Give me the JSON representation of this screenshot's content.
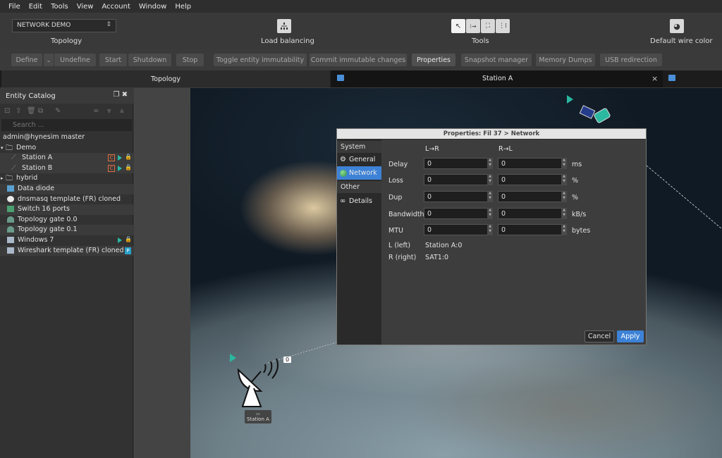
{
  "menu": [
    "File",
    "Edit",
    "Tools",
    "View",
    "Account",
    "Window",
    "Help"
  ],
  "toolbar": {
    "project": "NETWORK DEMO",
    "topology_label": "Topology",
    "load_balancing_label": "Load balancing",
    "tools_label": "Tools",
    "wire_color_label": "Default wire color"
  },
  "actions": {
    "define": "Define",
    "undefine": "Undefine",
    "start": "Start",
    "shutdown": "Shutdown",
    "stop": "Stop",
    "toggle": "Toggle entity immutability",
    "commit": "Commit immutable changes",
    "properties": "Properties",
    "snapshot": "Snapshot manager",
    "memory": "Memory Dumps",
    "usb": "USB redirection"
  },
  "tabs": {
    "topology": "Topology",
    "station": "Station A"
  },
  "catalog": {
    "title": "Entity Catalog",
    "search_placeholder": "Search ...",
    "items": [
      {
        "label": "admin@hynesim master"
      },
      {
        "label": "Demo"
      },
      {
        "label": "Station A",
        "badge": "C"
      },
      {
        "label": "Station B",
        "badge": "C"
      },
      {
        "label": "hybrid"
      },
      {
        "label": "Data diode"
      },
      {
        "label": "dnsmasq template (FR) cloned"
      },
      {
        "label": "Switch 16 ports"
      },
      {
        "label": "Topology gate 0.0"
      },
      {
        "label": "Topology gate 0.1"
      },
      {
        "label": "Windows 7"
      },
      {
        "label": "Wireshark template (FR) cloned",
        "badge": "P"
      }
    ]
  },
  "dialog": {
    "title": "Properties: Fil 37 > Network",
    "nav": {
      "system": "System",
      "general": "General",
      "network": "Network",
      "other": "Other",
      "details": "Details"
    },
    "col_lr": "L→R",
    "col_rl": "R→L",
    "rows": [
      {
        "label": "Delay",
        "lr": "0",
        "rl": "0",
        "unit": "ms"
      },
      {
        "label": "Loss",
        "lr": "0",
        "rl": "0",
        "unit": "%"
      },
      {
        "label": "Dup",
        "lr": "0",
        "rl": "0",
        "unit": "%"
      },
      {
        "label": "Bandwidth",
        "lr": "0",
        "rl": "0",
        "unit": "kB/s"
      },
      {
        "label": "MTU",
        "lr": "0",
        "rl": "0",
        "unit": "bytes"
      }
    ],
    "left_label": "L (left)",
    "left_value": "Station A:0",
    "right_label": "R (right)",
    "right_value": "SAT1:0",
    "cancel": "Cancel",
    "apply": "Apply"
  },
  "canvas": {
    "station_a_label": "Station A",
    "dish_count": "0"
  }
}
